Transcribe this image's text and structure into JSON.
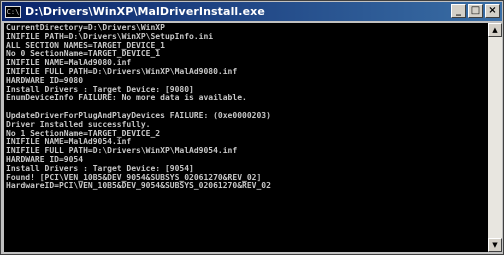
{
  "window": {
    "title": "D:\\Drivers\\WinXP\\MalDriverInstall.exe",
    "icon_text": "C:\\",
    "controls": {
      "minimize": "_",
      "maximize": "□",
      "close": "×"
    }
  },
  "console": {
    "lines": [
      "CurrentDirectory=D:\\Drivers\\WinXP",
      "INIFILE PATH=D:\\Drivers\\WinXP\\SetupInfo.ini",
      "ALL SECTION NAMES=TARGET_DEVICE_1",
      "No 0 SectionName=TARGET_DEVICE_1",
      "INIFILE NAME=MalAd9080.inf",
      "INIFILE FULL PATH=D:\\Drivers\\WinXP\\MalAd9080.inf",
      "HARDWARE ID=9080",
      "Install Drivers : Target Device: [9080]",
      "EnumDeviceInfo FAILURE: No more data is available.",
      "",
      "UpdateDriverForPlugAndPlayDevices FAILURE: (0xe0000203)",
      "Driver Installed successfully.",
      "No 1 SectionName=TARGET_DEVICE_2",
      "INIFILE NAME=MalAd9054.inf",
      "INIFILE FULL PATH=D:\\Drivers\\WinXP\\MalAd9054.inf",
      "HARDWARE ID=9054",
      "Install Drivers : Target Device: [9054]",
      "Found! [PCI\\VEN_10B5&DEV_9054&SUBSYS_02061270&REV_02]",
      "HardwareID=PCI\\VEN_10B5&DEV_9054&SUBSYS_02061270&REV_02"
    ]
  },
  "scrollbar": {
    "up_arrow": "▲",
    "down_arrow": "▼"
  }
}
